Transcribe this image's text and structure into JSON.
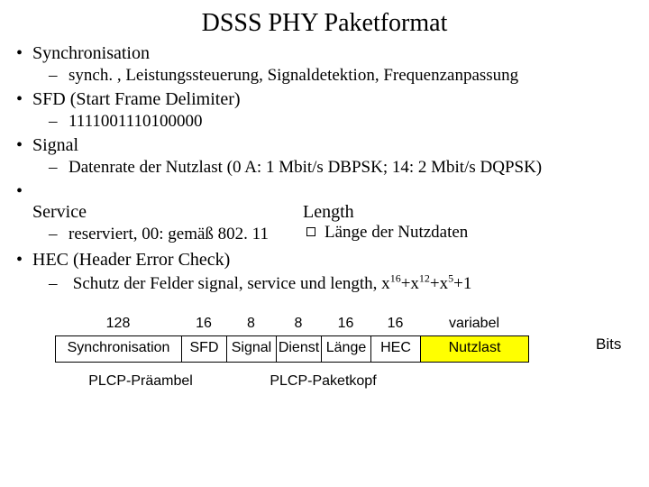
{
  "title": "DSSS PHY Paketformat",
  "bullets": {
    "b1": "Synchronisation",
    "b1s": "synch. , Leistungssteuerung, Signaldetektion, Frequenzanpassung",
    "b2": "SFD (Start Frame Delimiter)",
    "b2s": "1111001110100000",
    "b3": "Signal",
    "b3s": "Datenrate der Nutzlast (0 A: 1 Mbit/s DBPSK; 14: 2 Mbit/s DQPSK)",
    "b4": "Service",
    "b4s": "reserviert, 00: gemäß 802. 11",
    "b4r": "Length",
    "b4rs": "Länge der Nutzdaten",
    "b5": "HEC (Header Error Check)",
    "b5s_pre": "Schutz der Felder signal, service und length, x",
    "e1": "16",
    "p1": "+x",
    "e2": "12",
    "p2": "+x",
    "e3": "5",
    "p3": "+1"
  },
  "diagram": {
    "nums": {
      "sync": "128",
      "sfd": "16",
      "signal": "8",
      "dienst": "8",
      "lange": "16",
      "hec": "16",
      "var": "variabel"
    },
    "boxes": {
      "sync": "Synchronisation",
      "sfd": "SFD",
      "signal": "Signal",
      "dienst": "Dienst",
      "lange": "Länge",
      "hec": "HEC",
      "var": "Nutzlast"
    },
    "bits": "Bits",
    "label_preamble": "PLCP-Präambel",
    "label_header": "PLCP-Paketkopf"
  }
}
